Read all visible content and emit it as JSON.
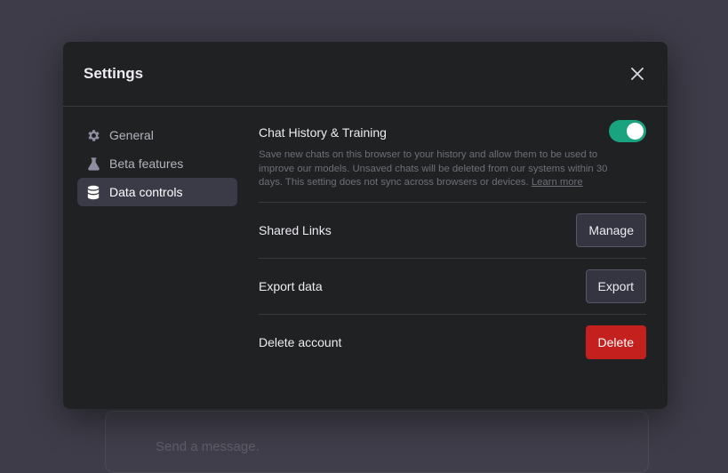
{
  "backdrop": {
    "input_placeholder": "Send a message."
  },
  "modal": {
    "title": "Settings",
    "close_icon": "close-icon"
  },
  "sidebar": {
    "items": [
      {
        "label": "General",
        "icon": "gear-icon",
        "active": false
      },
      {
        "label": "Beta features",
        "icon": "flask-icon",
        "active": false
      },
      {
        "label": "Data controls",
        "icon": "database-icon",
        "active": true
      }
    ]
  },
  "content": {
    "chat_history": {
      "title": "Chat History & Training",
      "description": "Save new chats on this browser to your history and allow them to be used to improve our models. Unsaved chats will be deleted from our systems within 30 days. This setting does not sync across browsers or devices.",
      "learn_more": "Learn more",
      "enabled": true
    },
    "shared_links": {
      "label": "Shared Links",
      "button": "Manage"
    },
    "export_data": {
      "label": "Export data",
      "button": "Export"
    },
    "delete_account": {
      "label": "Delete account",
      "button": "Delete"
    }
  },
  "colors": {
    "toggle_on": "#19a37f",
    "danger": "#c4201e",
    "modal_bg": "#202123"
  }
}
